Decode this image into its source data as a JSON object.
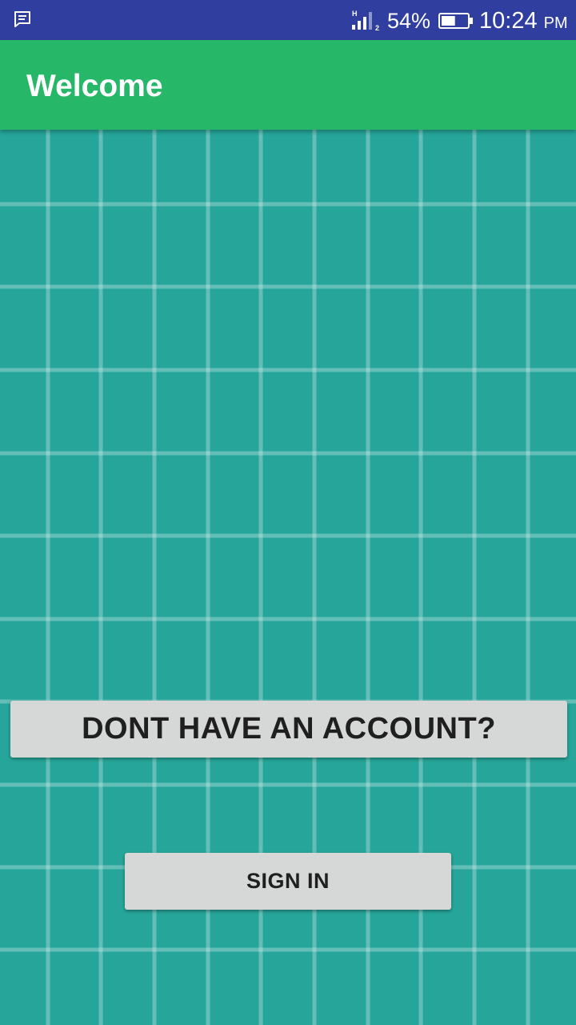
{
  "status_bar": {
    "notification_icon": "message-icon",
    "network_label": "H",
    "sim_label": "2",
    "battery_percent": "54%",
    "battery_level": 0.54,
    "time": "10:24",
    "ampm": "PM"
  },
  "app_bar": {
    "title": "Welcome"
  },
  "main": {
    "signup_prompt_label": "DONT HAVE AN ACCOUNT?",
    "signin_label": "SIGN IN"
  },
  "colors": {
    "status_bar": "#303f9f",
    "app_bar": "#26b768",
    "background": "#26a69a",
    "button": "#d6d7d7",
    "button_text": "#1f1f1f"
  }
}
